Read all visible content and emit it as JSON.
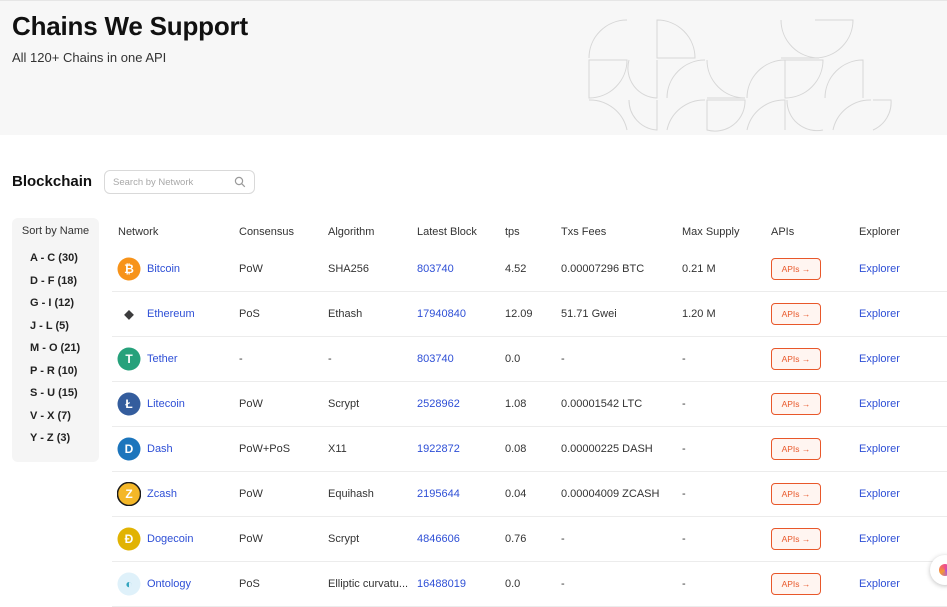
{
  "hero": {
    "title": "Chains We Support",
    "subtitle": "All 120+ Chains in one API"
  },
  "section": {
    "title": "Blockchain",
    "search_placeholder": "Search by Network"
  },
  "sort": {
    "heading": "Sort by Name",
    "items": [
      "A - C  (30)",
      "D - F  (18)",
      "G - I  (12)",
      "J - L  (5)",
      "M - O  (21)",
      "P - R  (10)",
      "S - U  (15)",
      "V - X  (7)",
      "Y - Z  (3)"
    ]
  },
  "table": {
    "headers": [
      "Network",
      "Consensus",
      "Algorithm",
      "Latest Block",
      "tps",
      "Txs Fees",
      "Max Supply",
      "APIs",
      "Explorer"
    ],
    "api_label": "APIs →",
    "explorer_label": "Explorer",
    "rows": [
      {
        "network": "Bitcoin",
        "consensus": "PoW",
        "algorithm": "SHA256",
        "block": "803740",
        "tps": "4.52",
        "fees": "0.00007296 BTC",
        "supply": "0.21 M",
        "icon": "bitcoin-icon",
        "color": "#f7931a"
      },
      {
        "network": "Ethereum",
        "consensus": "PoS",
        "algorithm": "Ethash",
        "block": "17940840",
        "tps": "12.09",
        "fees": "51.71 Gwei",
        "supply": "1.20 M",
        "icon": "ethereum-icon",
        "color": "#3c3c3d"
      },
      {
        "network": "Tether",
        "consensus": "-",
        "algorithm": "-",
        "block": "803740",
        "tps": "0.0",
        "fees": "-",
        "supply": "-",
        "icon": "tether-icon",
        "color": "#26a17b"
      },
      {
        "network": "Litecoin",
        "consensus": "PoW",
        "algorithm": "Scrypt",
        "block": "2528962",
        "tps": "1.08",
        "fees": "0.00001542 LTC",
        "supply": "-",
        "icon": "litecoin-icon",
        "color": "#345d9d"
      },
      {
        "network": "Dash",
        "consensus": "PoW+PoS",
        "algorithm": "X11",
        "block": "1922872",
        "tps": "0.08",
        "fees": "0.00000225 DASH",
        "supply": "-",
        "icon": "dash-icon",
        "color": "#1c75bc"
      },
      {
        "network": "Zcash",
        "consensus": "PoW",
        "algorithm": "Equihash",
        "block": "2195644",
        "tps": "0.04",
        "fees": "0.00004009 ZCASH",
        "supply": "-",
        "icon": "zcash-icon",
        "color": "#f4b728"
      },
      {
        "network": "Dogecoin",
        "consensus": "PoW",
        "algorithm": "Scrypt",
        "block": "4846606",
        "tps": "0.76",
        "fees": "-",
        "supply": "-",
        "icon": "dogecoin-icon",
        "color": "#e1b303"
      },
      {
        "network": "Ontology",
        "consensus": "PoS",
        "algorithm": "Elliptic curvatu...",
        "block": "16488019",
        "tps": "0.0",
        "fees": "-",
        "supply": "-",
        "icon": "ontology-icon",
        "color": "#32a4be"
      }
    ]
  },
  "colors": {
    "link": "#2e4fd6",
    "api_accent": "#e8572a",
    "hero_bg": "#f7f7f7",
    "sort_bg": "#f5f5f5"
  }
}
